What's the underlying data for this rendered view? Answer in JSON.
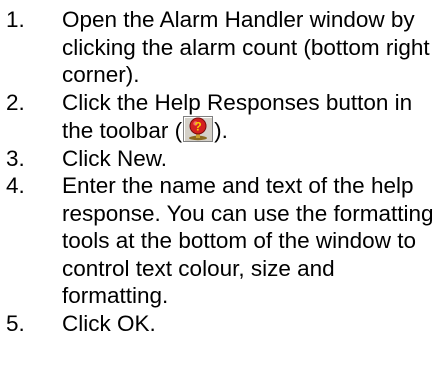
{
  "steps": [
    {
      "number": "1.",
      "text": "Open the Alarm Handler window by clicking the alarm count (bottom right corner)."
    },
    {
      "number": "2.",
      "text_before_icon": "Click the Help Responses button in the toolbar (",
      "icon": "help-responses-icon",
      "text_after_icon": ")."
    },
    {
      "number": "3.",
      "text": "Click New."
    },
    {
      "number": "4.",
      "text": "Enter the name and text of the help response. You can use the formatting tools at the bottom of the window to control text colour, size and formatting."
    },
    {
      "number": "5.",
      "text": "Click OK."
    }
  ],
  "colors": {
    "text": "#000000",
    "background": "#ffffff",
    "icon_frame": "#d4d0c8",
    "icon_red": "#d42020",
    "icon_yellow": "#f5d000"
  }
}
